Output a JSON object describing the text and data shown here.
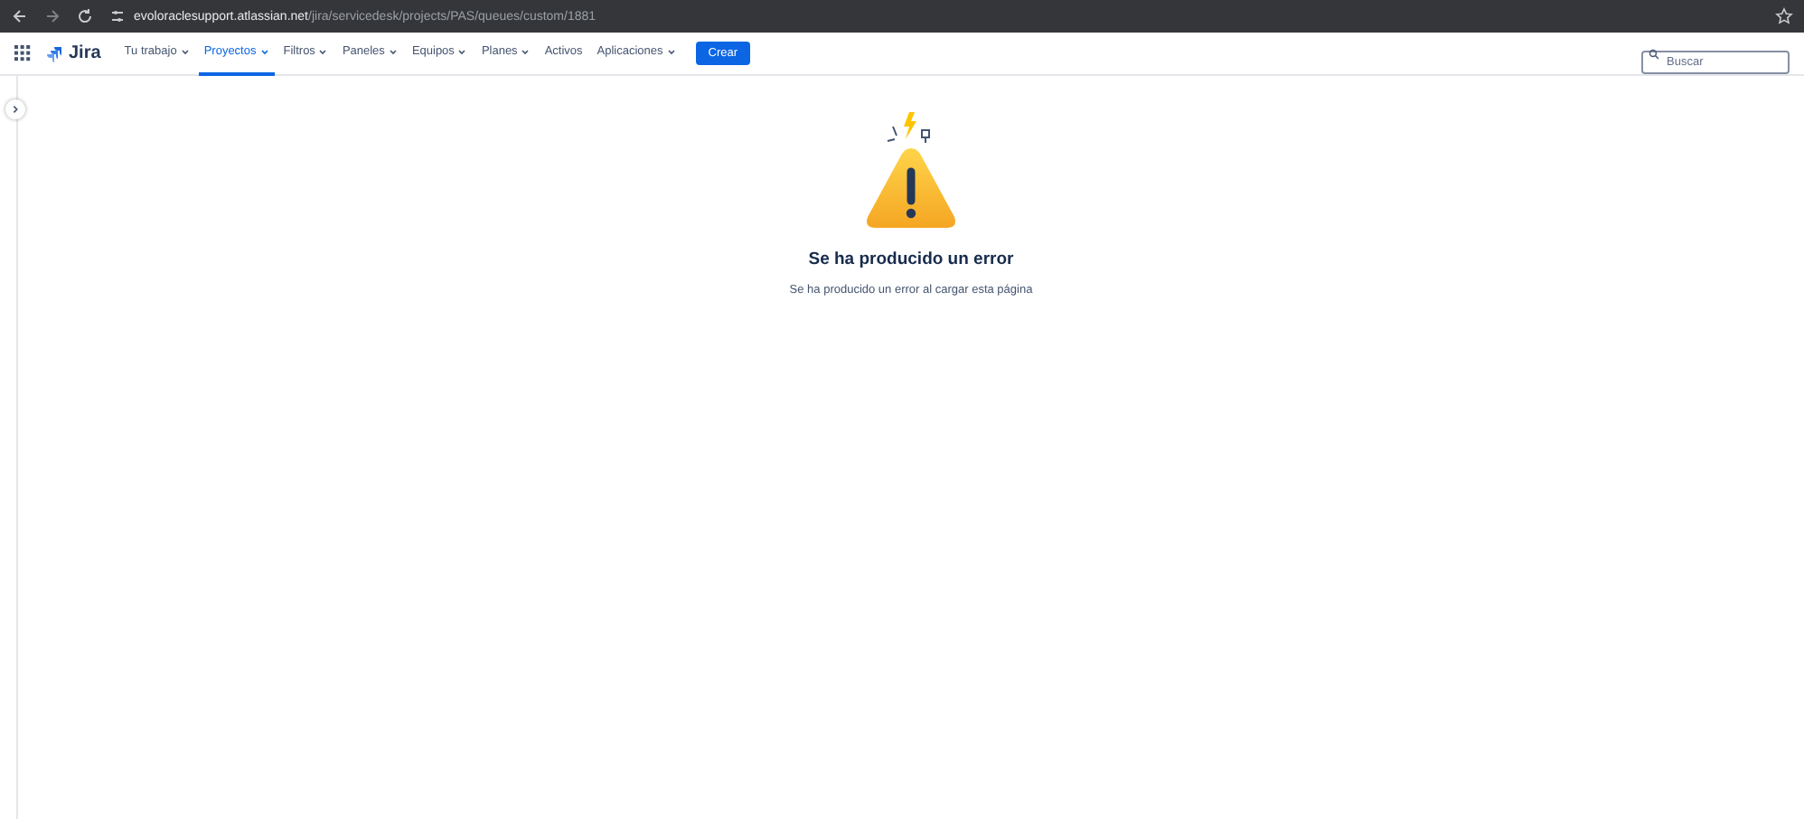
{
  "browser": {
    "url_host": "evoloraclesupport.atlassian.net",
    "url_path": "/jira/servicedesk/projects/PAS/queues/custom/1881"
  },
  "nav": {
    "product": "Jira",
    "items": [
      {
        "label": "Tu trabajo",
        "dropdown": true,
        "selected": false
      },
      {
        "label": "Proyectos",
        "dropdown": true,
        "selected": true
      },
      {
        "label": "Filtros",
        "dropdown": true,
        "selected": false
      },
      {
        "label": "Paneles",
        "dropdown": true,
        "selected": false
      },
      {
        "label": "Equipos",
        "dropdown": true,
        "selected": false
      },
      {
        "label": "Planes",
        "dropdown": true,
        "selected": false
      },
      {
        "label": "Activos",
        "dropdown": false,
        "selected": false
      },
      {
        "label": "Aplicaciones",
        "dropdown": true,
        "selected": false
      }
    ],
    "create_button": "Crear",
    "search": {
      "placeholder": "Buscar"
    }
  },
  "error": {
    "title": "Se ha producido un error",
    "message": "Se ha producido un error al cargar esta página"
  }
}
